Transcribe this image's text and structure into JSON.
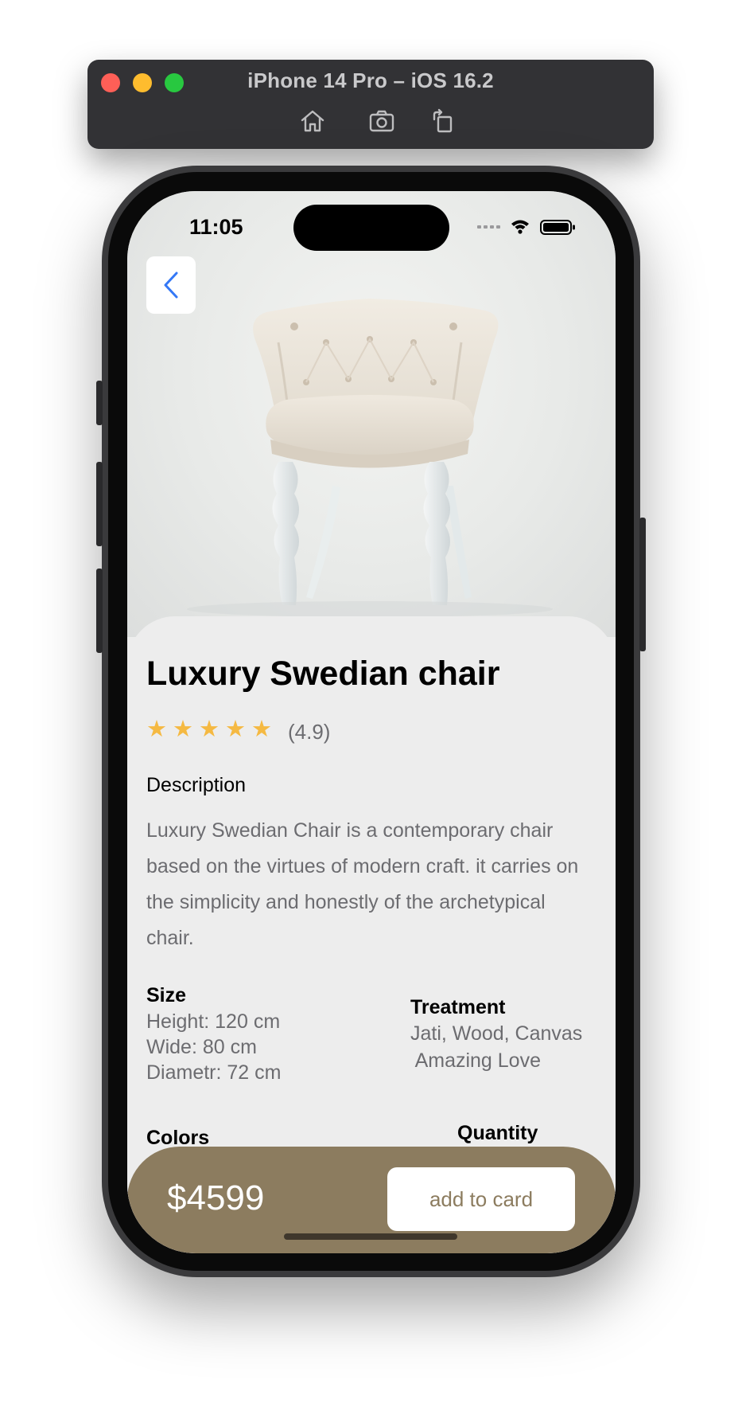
{
  "simulator": {
    "title": "iPhone 14 Pro – iOS 16.2",
    "tools": [
      "home-icon",
      "screenshot-icon",
      "rotate-icon"
    ]
  },
  "status_bar": {
    "time": "11:05",
    "icons": [
      "signal-icon",
      "wifi-icon",
      "battery-icon"
    ]
  },
  "nav": {
    "back_icon": "chevron-left-icon"
  },
  "product": {
    "title": "Luxury Swedian chair",
    "rating": "(4.9)",
    "stars": 5,
    "description_heading": "Description",
    "description": "Luxury Swedian Chair is a contemporary chair based on the virtues of modern craft. it carries on the simplicity and honestly of the archetypical chair.",
    "size": {
      "heading": "Size",
      "lines": [
        "Height: 120 cm",
        "Wide: 80 cm",
        "Diametr: 72 cm"
      ]
    },
    "treatment": {
      "heading": "Treatment",
      "lines": [
        "Jati, Wood, Canvas",
        " Amazing Love"
      ]
    },
    "colors_heading": "Colors",
    "quantity_heading": "Quantity"
  },
  "checkout": {
    "price": "$4599",
    "add_label": "add to card"
  },
  "colors": {
    "accent": "#8c7c5f",
    "star": "#f5b942",
    "back_chevron": "#3478f6"
  }
}
